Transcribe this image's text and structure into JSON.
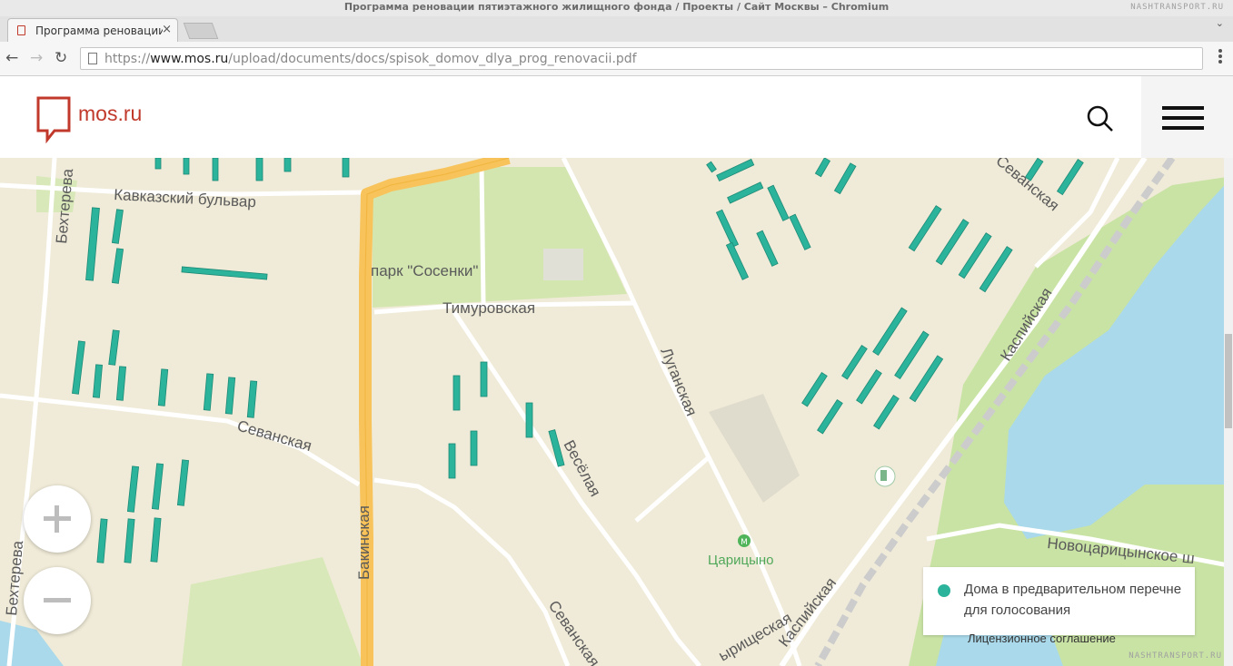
{
  "window": {
    "title": "Программа реновации пятиэтажного жилищного фонда / Проекты / Сайт Москвы – Chromium",
    "watermark": "NASHTRANSPORT.RU"
  },
  "tab": {
    "title": "Программа реновации пятиэтажного жилищного фонда / Проекты / Сайт Москвы",
    "close": "×"
  },
  "address_bar": {
    "scheme": "https://",
    "host": "www.mos.ru",
    "path": "/upload/documents/docs/spisok_domov_dlya_prog_renovacii.pdf"
  },
  "site": {
    "logo_text": "mos.ru",
    "brand_color": "#c0392b"
  },
  "map": {
    "labels": {
      "kavkazsky": "Кавказский бульвар",
      "park": "парк \"Сосенки\"",
      "timurovskaya": "Тимуровская",
      "sevanskaya1": "Севанская",
      "sevanskaya2": "Севанская",
      "veselaya": "Весёлая",
      "luganskaya": "Луганская",
      "kaspiyskaya1": "Каспийская",
      "kaspiyskaya2": "Каспийская",
      "bakinskaya": "Бакинская",
      "bekhtereva1": "Бехтерева",
      "bekhtereva2": "Бехтерева",
      "tsaritsyno": "Царицыно",
      "novotsaritsynskoe": "Новоцарицынское ш",
      "sevanskaya_top": "Севанская",
      "tovarishcheskaya": "ырищеская"
    },
    "colors": {
      "building": "#2bb39b",
      "road_major": "#f7c35a",
      "park": "#d3e6b0",
      "water": "#a9d9ea"
    },
    "zoom_in_label": "+",
    "zoom_out_label": "−"
  },
  "legend": {
    "text": "Дома в предварительном перечне для голосования"
  },
  "license_link": "Лицензионное соглашение"
}
